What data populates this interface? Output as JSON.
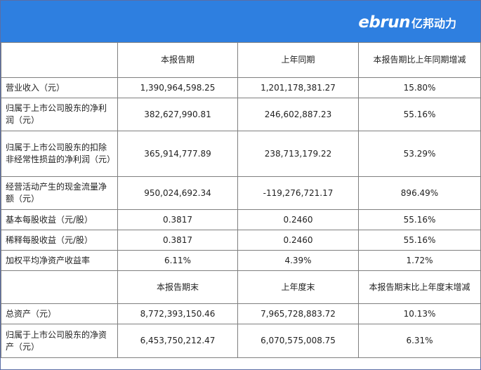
{
  "logo": {
    "en": "ebrun",
    "cn": "亿邦动力"
  },
  "table": {
    "header1": [
      "",
      "本报告期",
      "上年同期",
      "本报告期比上年同期增减"
    ],
    "rows1": [
      [
        "营业收入（元）",
        "1,390,964,598.25",
        "1,201,178,381.27",
        "15.80%"
      ],
      [
        "归属于上市公司股东的净利润（元）",
        "382,627,990.81",
        "246,602,887.23",
        "55.16%"
      ],
      [
        "归属于上市公司股东的扣除非经常性损益的净利润（元）",
        "365,914,777.89",
        "238,713,179.22",
        "53.29%"
      ],
      [
        "经营活动产生的现金流量净额（元）",
        "950,024,692.34",
        "-119,276,721.17",
        "896.49%"
      ],
      [
        "基本每股收益（元/股）",
        "0.3817",
        "0.2460",
        "55.16%"
      ],
      [
        "稀释每股收益（元/股）",
        "0.3817",
        "0.2460",
        "55.16%"
      ],
      [
        "加权平均净资产收益率",
        "6.11%",
        "4.39%",
        "1.72%"
      ]
    ],
    "header2": [
      "",
      "本报告期末",
      "上年度末",
      "本报告期末比上年度末增减"
    ],
    "rows2": [
      [
        "总资产（元）",
        "8,772,393,150.46",
        "7,965,728,883.72",
        "10.13%"
      ],
      [
        "归属于上市公司股东的净资产（元）",
        "6,453,750,212.47",
        "6,070,575,008.75",
        "6.31%"
      ]
    ]
  }
}
